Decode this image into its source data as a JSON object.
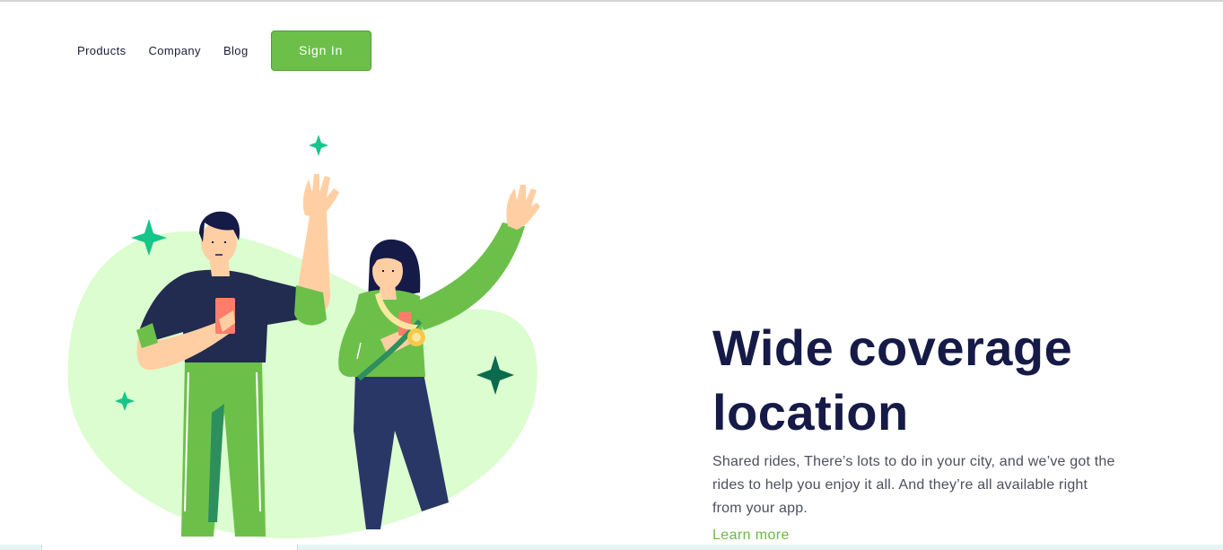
{
  "nav": {
    "links": [
      "Products",
      "Company",
      "Blog"
    ],
    "signin_label": "Sign In"
  },
  "hero": {
    "title_line1": "Wide coverage",
    "title_line2": "location",
    "description": "Shared rides, There’s lots to do in your city, and we’ve got the rides to help you enjoy it all. And they’re all available right from your app.",
    "cta": "Learn more"
  },
  "colors": {
    "brand_green": "#6cc04a",
    "title_navy": "#151a47",
    "blob": "#dcfdcf",
    "sparkle": "#16c58a"
  },
  "icons": {
    "sparkles": "four-point-star"
  }
}
